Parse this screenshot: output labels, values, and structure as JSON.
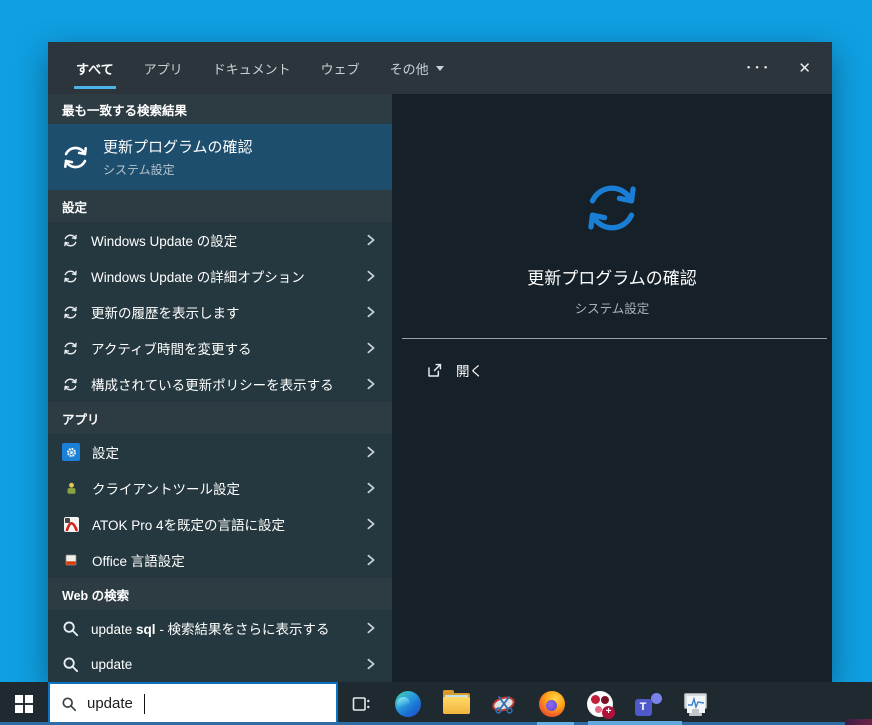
{
  "tabs": {
    "items": [
      {
        "label": "すべて",
        "selected": true
      },
      {
        "label": "アプリ",
        "selected": false
      },
      {
        "label": "ドキュメント",
        "selected": false
      },
      {
        "label": "ウェブ",
        "selected": false
      },
      {
        "label": "その他",
        "selected": false,
        "has_dropdown": true
      }
    ],
    "more": "･･･",
    "close": "✕"
  },
  "best_match": {
    "header": "最も一致する検索結果",
    "title": "更新プログラムの確認",
    "subtitle": "システム設定"
  },
  "settings": {
    "header": "設定",
    "items": [
      "Windows Update の設定",
      "Windows Update の詳細オプション",
      "更新の履歴を表示します",
      "アクティブ時間を変更する",
      "構成されている更新ポリシーを表示する"
    ]
  },
  "apps": {
    "header": "アプリ",
    "items": [
      {
        "label": "設定",
        "icon": "settings-gear-icon"
      },
      {
        "label": "クライアントツール設定",
        "icon": "client-tools-icon"
      },
      {
        "label": "ATOK Pro 4を既定の言語に設定",
        "icon": "atok-icon"
      },
      {
        "label": "Office 言語設定",
        "icon": "office-language-icon"
      }
    ]
  },
  "web": {
    "header": "Web の検索",
    "items": [
      {
        "typed": "update ",
        "bold": "sql",
        "suffix": " - 検索結果をさらに表示する"
      },
      {
        "typed": "update",
        "bold": "",
        "suffix": ""
      }
    ]
  },
  "preview": {
    "title": "更新プログラムの確認",
    "subtitle": "システム設定",
    "open_label": "開く"
  },
  "taskbar": {
    "search_value": "update",
    "icons": [
      "start",
      "task-view",
      "edge",
      "file-explorer",
      "snipping-tool",
      "firefox",
      "red-circle-app",
      "teams",
      "system-monitor"
    ]
  },
  "colors": {
    "desktop": "#0f9fe2",
    "flyout_header": "#2b353b",
    "left_list": "#25383f",
    "right_panel": "#152028",
    "best_match_highlight": "#1d4e6e",
    "tab_underline": "#4db2e8",
    "accent": "#0078d7",
    "preview_icon_blue": "#1a7fd4"
  }
}
